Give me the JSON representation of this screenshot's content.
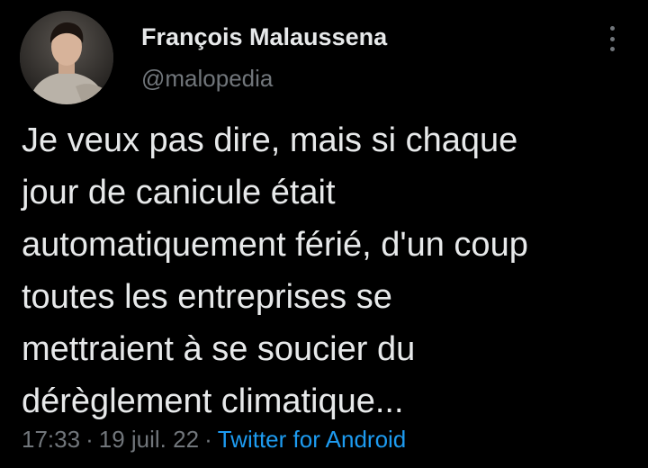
{
  "author": {
    "display_name": "François Malaussena",
    "handle": "@malopedia",
    "avatar_icon": "profile-photo"
  },
  "tweet": {
    "lines": [
      "Je veux pas dire, mais si chaque",
      "jour de canicule était",
      "automatiquement férié, d'un coup",
      "toutes les entreprises se",
      "mettraient à se soucier du",
      "dérèglement climatique..."
    ]
  },
  "meta": {
    "time": "17:33",
    "separator": "·",
    "date": "19 juil. 22",
    "source": "Twitter for Android"
  },
  "menu": {
    "icon": "more-vertical-icon"
  },
  "colors": {
    "background": "#000000",
    "text": "#e7e9ea",
    "secondary": "#71767b",
    "link": "#1d9bf0"
  }
}
